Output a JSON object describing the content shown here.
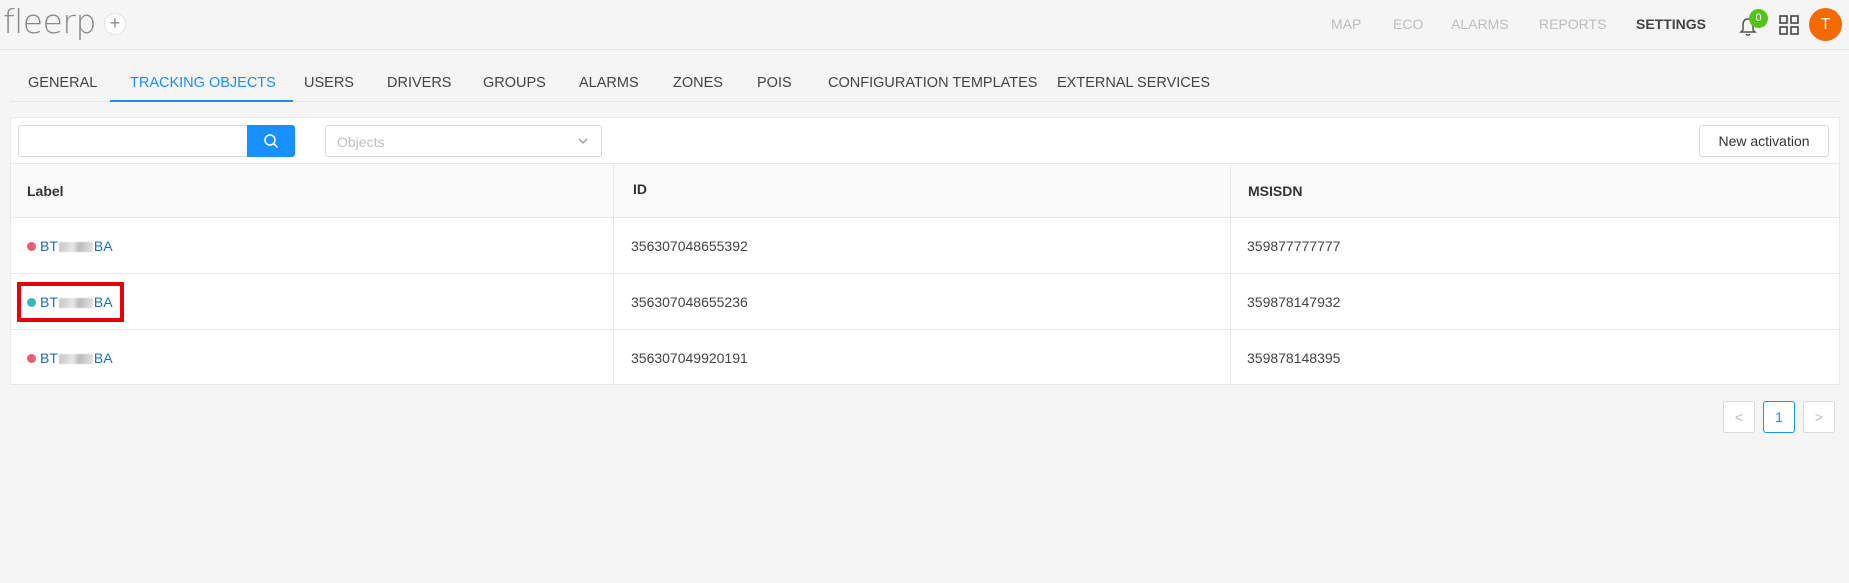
{
  "app": {
    "logo": "fleerp",
    "add_label": "+",
    "top_nav": [
      {
        "label": "MAP",
        "active": false
      },
      {
        "label": "ECO",
        "active": false
      },
      {
        "label": "ALARMS",
        "active": false
      },
      {
        "label": "REPORTS",
        "active": false
      },
      {
        "label": "SETTINGS",
        "active": true
      }
    ],
    "notifications_count": "0",
    "avatar_initial": "T"
  },
  "tabs": [
    {
      "label": "GENERAL",
      "active": false
    },
    {
      "label": "TRACKING OBJECTS",
      "active": true
    },
    {
      "label": "USERS",
      "active": false
    },
    {
      "label": "DRIVERS",
      "active": false
    },
    {
      "label": "GROUPS",
      "active": false
    },
    {
      "label": "ALARMS",
      "active": false
    },
    {
      "label": "ZONES",
      "active": false
    },
    {
      "label": "POIS",
      "active": false
    },
    {
      "label": "CONFIGURATION TEMPLATES",
      "active": false
    },
    {
      "label": "EXTERNAL SERVICES",
      "active": false
    }
  ],
  "toolbar": {
    "search_value": "",
    "objects_placeholder": "Objects",
    "new_activation_label": "New activation"
  },
  "table": {
    "columns": [
      "Label",
      "ID",
      "MSISDN"
    ],
    "rows": [
      {
        "label_prefix": "BT",
        "label_suffix": "BA",
        "status_color": "#eb5d74",
        "id": "356307048655392",
        "msisdn": "359877777777"
      },
      {
        "label_prefix": "BT",
        "label_suffix": "BA",
        "status_color": "#36b9b9",
        "id": "356307048655236",
        "msisdn": "359878147932"
      },
      {
        "label_prefix": "BT",
        "label_suffix": "BA",
        "status_color": "#eb5d74",
        "id": "356307049920191",
        "msisdn": "359878148395"
      }
    ]
  },
  "pagination": {
    "prev": "<",
    "current": "1",
    "next": ">"
  },
  "colors": {
    "accent": "#1890ff",
    "avatar": "#f56a00",
    "badge": "#52c41a",
    "highlight": "#e8000b"
  }
}
